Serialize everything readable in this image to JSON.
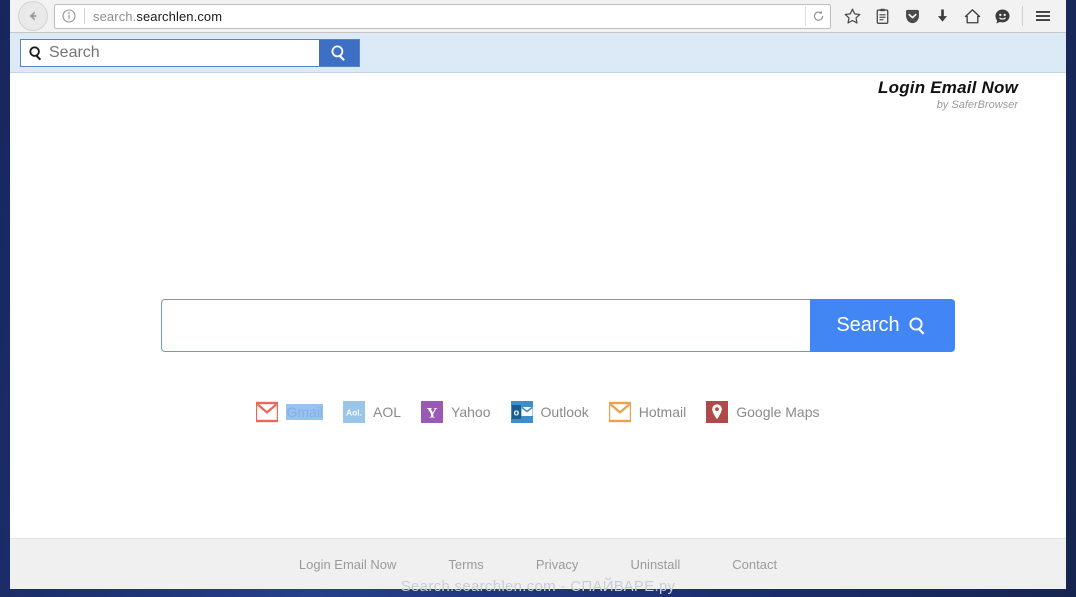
{
  "browser": {
    "back_button": "back-arrow",
    "identity_icon": "info-circle-icon",
    "url_prefix": "search.",
    "url_host": "searchlen.com",
    "reload_icon": "reload-icon",
    "toolbar_icons": [
      {
        "name": "bookmark-star-icon",
        "label": "Bookmark"
      },
      {
        "name": "reading-list-icon",
        "label": "Reading List"
      },
      {
        "name": "pocket-icon",
        "label": "Pocket"
      },
      {
        "name": "downloads-icon",
        "label": "Downloads"
      },
      {
        "name": "home-icon",
        "label": "Home"
      },
      {
        "name": "smiley-feedback-icon",
        "label": "Feedback"
      },
      {
        "name": "menu-icon",
        "label": "Open menu"
      }
    ]
  },
  "search_toolbar": {
    "placeholder": "Search",
    "input_value": "",
    "magnifier_icon": "search-icon",
    "button_icon": "search-icon",
    "background_color": "#dce9f7",
    "button_color": "#3d6fc4"
  },
  "brand": {
    "title": "Login Email Now",
    "subtitle": "by SaferBrowser"
  },
  "main_search": {
    "input_value": "",
    "placeholder": "",
    "button_label": "Search",
    "button_icon": "search-icon",
    "button_color": "#4285f4",
    "border_color": "#6a9ad6"
  },
  "quick_links": [
    {
      "label": "Gmail",
      "icon": "gmail-envelope-icon",
      "icon_color": "#e8685a",
      "selected": true
    },
    {
      "label": "AOL",
      "icon": "aol-icon",
      "icon_color": "#9ac5ea",
      "selected": false
    },
    {
      "label": "Yahoo",
      "icon": "yahoo-y-icon",
      "icon_color": "#9b59b6",
      "selected": false
    },
    {
      "label": "Outlook",
      "icon": "outlook-icon",
      "icon_color": "#3d8ec9",
      "selected": false
    },
    {
      "label": "Hotmail",
      "icon": "hotmail-envelope-icon",
      "icon_color": "#f0a04b",
      "selected": false
    },
    {
      "label": "Google Maps",
      "icon": "map-pin-icon",
      "icon_color": "#b04a4a",
      "selected": false
    }
  ],
  "footer": {
    "links": [
      {
        "label": "Login Email Now"
      },
      {
        "label": "Terms"
      },
      {
        "label": "Privacy"
      },
      {
        "label": "Uninstall"
      },
      {
        "label": "Contact"
      }
    ]
  },
  "watermark": {
    "text": "Search.searchlen.com - СПАЙВАРЕ.ру"
  }
}
